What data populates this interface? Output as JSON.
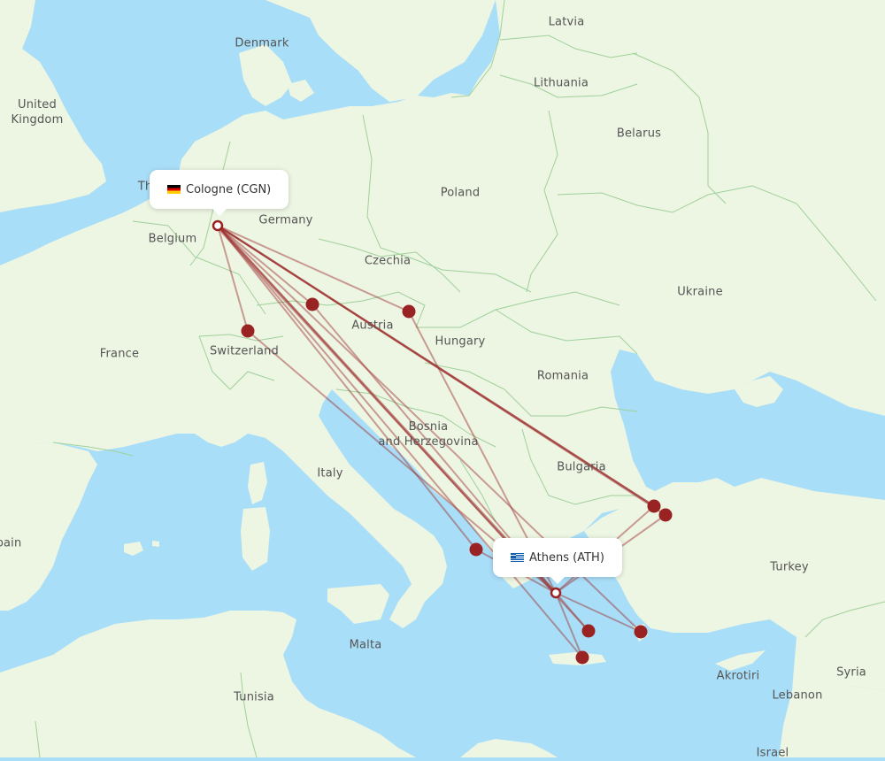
{
  "map": {
    "origin": {
      "name": "Cologne (CGN)",
      "flag": "germany-flag",
      "country_code": "DE"
    },
    "destination": {
      "name": "Athens (ATH)",
      "flag": "greece-flag",
      "country_code": "GR"
    },
    "route_color": "#9b2c2c",
    "marker_color": "#992222",
    "water_color": "#a9def8",
    "land_color": "#edf5e3",
    "country_labels": [
      {
        "id": "denmark",
        "text": "Denmark"
      },
      {
        "id": "latvia",
        "text": "Latvia"
      },
      {
        "id": "lithuania",
        "text": "Lithuania"
      },
      {
        "id": "united-kingdom",
        "text": "United\nKingdom"
      },
      {
        "id": "belarus",
        "text": "Belarus"
      },
      {
        "id": "poland",
        "text": "Poland"
      },
      {
        "id": "netherlands",
        "text": "Th"
      },
      {
        "id": "germany",
        "text": "Germany"
      },
      {
        "id": "belgium",
        "text": "Belgium"
      },
      {
        "id": "czechia",
        "text": "Czechia"
      },
      {
        "id": "ukraine",
        "text": "Ukraine"
      },
      {
        "id": "austria",
        "text": "Austria"
      },
      {
        "id": "hungary",
        "text": "Hungary"
      },
      {
        "id": "france",
        "text": "France"
      },
      {
        "id": "switzerland",
        "text": "Switzerland"
      },
      {
        "id": "romania",
        "text": "Romania"
      },
      {
        "id": "bosnia",
        "text": "Bosnia\nand Herzegovina"
      },
      {
        "id": "bulgaria",
        "text": "Bulgaria"
      },
      {
        "id": "italy",
        "text": "Italy"
      },
      {
        "id": "spain",
        "text": "pain"
      },
      {
        "id": "turkey",
        "text": "Turkey"
      },
      {
        "id": "malta",
        "text": "Malta"
      },
      {
        "id": "tunisia",
        "text": "Tunisia"
      },
      {
        "id": "akrotiri",
        "text": "Akrotiri"
      },
      {
        "id": "syria",
        "text": "Syria"
      },
      {
        "id": "lebanon",
        "text": "Lebanon"
      },
      {
        "id": "israel",
        "text": "Israel"
      }
    ],
    "stopovers": [
      {
        "id": "zurich"
      },
      {
        "id": "munich"
      },
      {
        "id": "vienna"
      },
      {
        "id": "istanbul"
      },
      {
        "id": "istanbul-saw"
      },
      {
        "id": "corfu"
      },
      {
        "id": "santorini"
      },
      {
        "id": "rhodes"
      },
      {
        "id": "heraklion"
      }
    ]
  }
}
